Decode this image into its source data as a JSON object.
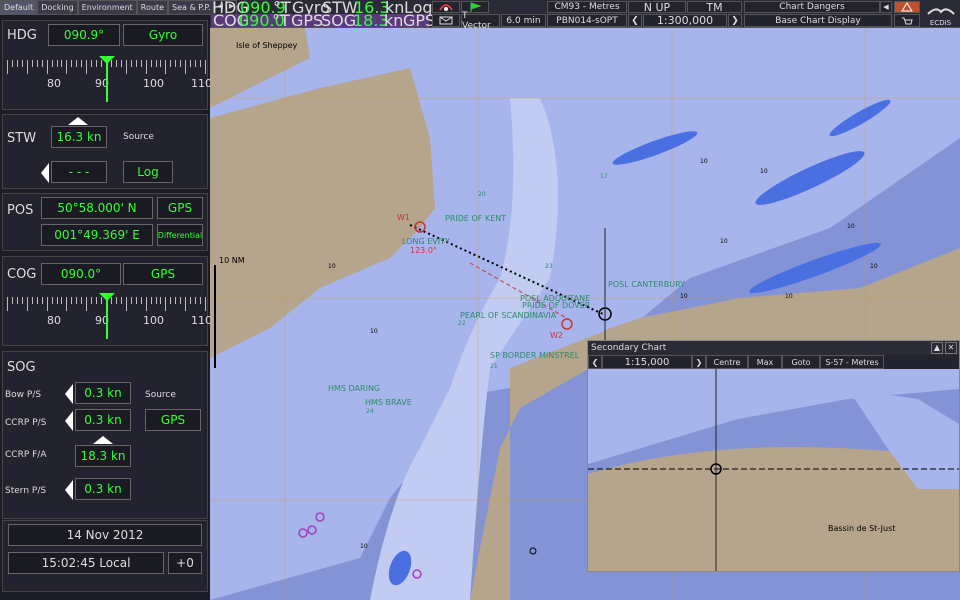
{
  "tabs": [
    "Default",
    "Docking",
    "Environment",
    "Route",
    "Sea & P.P."
  ],
  "topbar": {
    "hdg_label": "HDG",
    "hdg_value": "090.9",
    "hdg_unit": "°T",
    "hdg_src": "Gyro",
    "stw_label": "STW",
    "stw_value": "16.3",
    "stw_unit": "kn",
    "stw_src": "Log",
    "cog_label": "COG",
    "cog_value": "090.0",
    "cog_unit": "°T",
    "cog_src": "GPS",
    "sog_label": "SOG",
    "sog_value": "18.3",
    "sog_unit": "kn",
    "sog_src": "GPS",
    "tvector": "T Vector",
    "tvector_val": "6.0 min",
    "chart_units": "CM93 - Metres",
    "cell": "PBN014-sOPT",
    "orient": "N UP",
    "motion": "TM",
    "scale": "1:300,000",
    "dangers": "Chart Dangers",
    "base": "Base Chart Display",
    "brand": "ECDIS"
  },
  "left": {
    "hdg_label": "HDG",
    "hdg_value": "090.9°",
    "hdg_src": "Gyro",
    "hdg_scale": [
      "80",
      "90",
      "100",
      "110"
    ],
    "stw_label": "STW",
    "stw_value": "16.3 kn",
    "source_label": "Source",
    "stw_dashes": "- - -",
    "stw_src": "Log",
    "pos_label": "POS",
    "lat": "50°58.000' N",
    "lat_src": "GPS",
    "lon": "001°49.369' E",
    "lon_src": "Differential",
    "cog_label": "COG",
    "cog_value": "090.0°",
    "cog_src": "GPS",
    "cog_scale": [
      "80",
      "90",
      "100",
      "110"
    ],
    "sog_label": "SOG",
    "bow_label": "Bow P/S",
    "bow_value": "0.3 kn",
    "sog_source_label": "Source",
    "ccrp_ps_label": "CCRP  P/S",
    "ccrp_ps_value": "0.3 kn",
    "sog_src": "GPS",
    "ccrp_fa_label": "CCRP F/A",
    "ccrp_fa_value": "18.3 kn",
    "stern_label": "Stern P/S",
    "stern_value": "0.3 kn",
    "date": "14 Nov 2012",
    "time": "15:02:45 Local",
    "tz": "+0"
  },
  "chart": {
    "labels": [
      "Isle of Sheppey",
      "PRIDE OF KENT",
      "LONG EVITY",
      "POSL ADQUITANE",
      "PRIDE OF DOVER",
      "POSL CANTERBURY",
      "PEARL OF SCANDINAVIA",
      "SP BORDER MINSTREL",
      "HMS DARING",
      "HMS BRAVE",
      "W1",
      "W2",
      "123.0°",
      "10 NM"
    ],
    "depths": [
      "10",
      "10",
      "10",
      "10",
      "10",
      "10",
      "10",
      "10",
      "10",
      "10",
      "20",
      "23",
      "22",
      "21",
      "24",
      "17"
    ]
  },
  "secondary": {
    "title": "Secondary Chart",
    "scale": "1:15,000",
    "centre": "Centre",
    "max": "Max",
    "goto": "Goto",
    "units": "S-57 - Metres",
    "place": "Bassin de St-Just"
  }
}
